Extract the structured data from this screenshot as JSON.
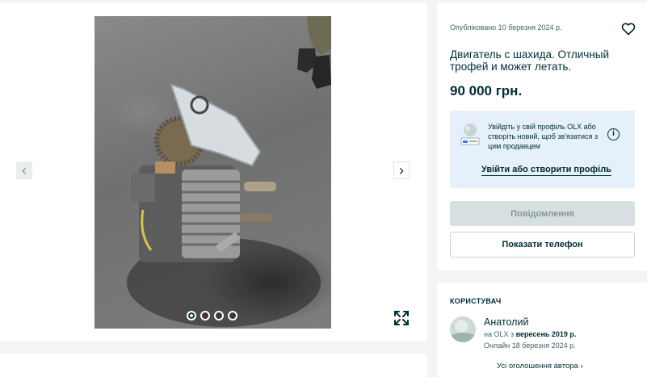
{
  "gallery": {
    "photo_alt": "",
    "prev_icon": "chevron-left-icon",
    "next_icon": "chevron-right-icon",
    "prev_glyph": "‹",
    "next_glyph": "›",
    "dots_count": 4,
    "active_dot": 0,
    "fullscreen_icon": "expand-icon"
  },
  "listing": {
    "published": "Опубліковано 10 березня 2024 р.",
    "title": "Двигатель с шахида. Отличный трофей и может летать.",
    "price": "90 000 грн.",
    "favorite_icon": "heart-icon"
  },
  "promo": {
    "text": "Увійдіть у свій профіль OLX або створіть новий, щоб зв'язатися з цим продавцем",
    "info_glyph": "i",
    "link": "Увійти або створити профіль"
  },
  "buttons": {
    "message": "Повідомлення",
    "phone": "Показати телефон"
  },
  "user": {
    "heading": "КОРИСТУВАЧ",
    "name": "Анатолий",
    "since_prefix": "на OLX з ",
    "since_date": "вересень 2019 р.",
    "online": "Онлайн 18 березня 2024 р.",
    "all_ads": "Усі оголошення автора ›"
  },
  "colors": {
    "primary_text": "#002f34",
    "secondary_text": "#406367",
    "promo_bg": "#e5f0fb",
    "disabled_bg": "#d8dfe0",
    "page_bg": "#f2f4f5"
  }
}
